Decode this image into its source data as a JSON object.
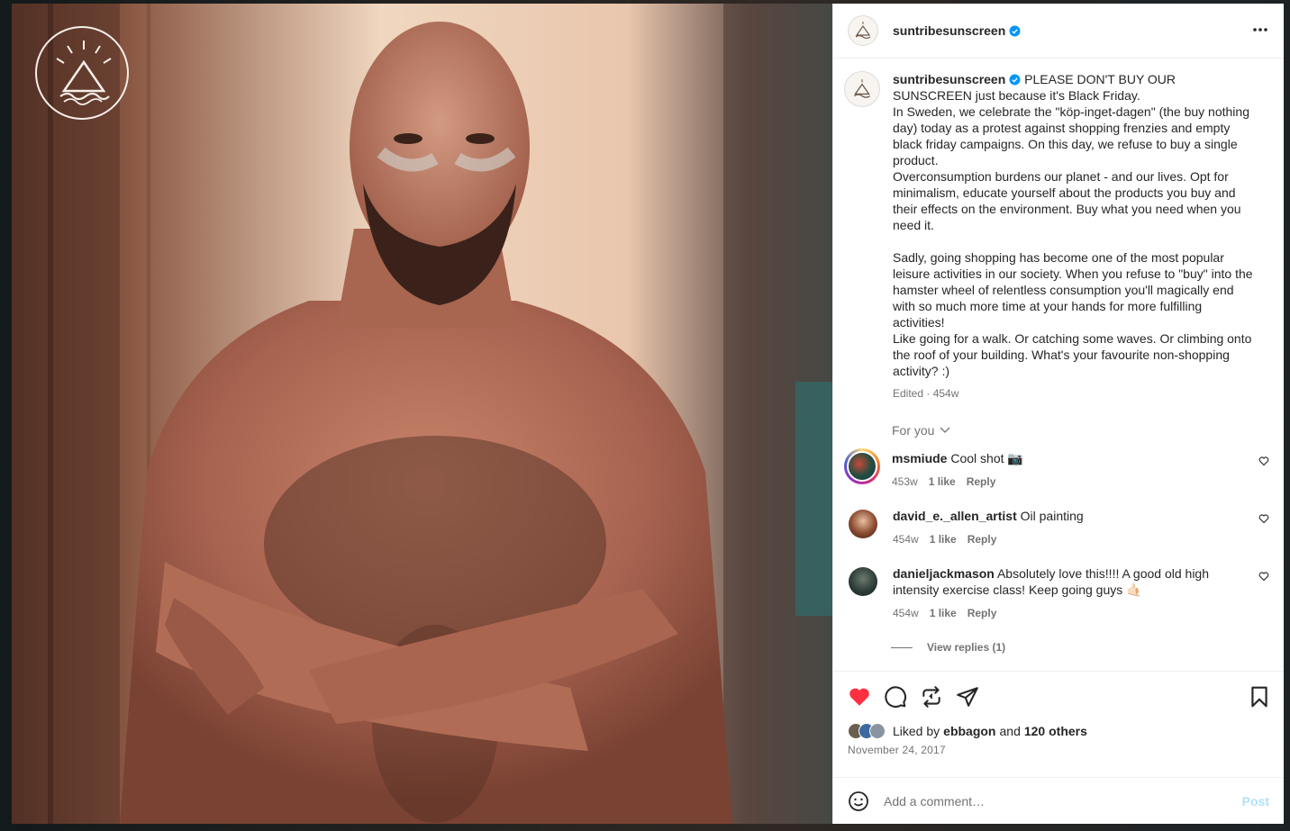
{
  "post": {
    "username": "suntribesunscreen",
    "caption_lead": "PLEASE DON'T BUY OUR SUNSCREEN just because it's Black Friday.",
    "caption_body": "In Sweden, we celebrate the \"köp-inget-dagen\" (the buy nothing day) today as a protest against shopping frenzies and empty black friday campaigns. On this day, we refuse to buy a single product.\nOverconsumption burdens our planet - and our lives. Opt for minimalism, educate yourself about the products you buy and their effects on the environment. Buy what you need when you need it.\n\nSadly, going shopping has become one of the most popular leisure activities in our society. When you refuse to \"buy\" into the hamster wheel of relentless consumption you'll magically end with so much more time at your hands for more fulfilling activities!\nLike going for a walk. Or catching some waves. Or climbing onto the roof of your building. What's your favourite non-shopping activity? :)",
    "caption_meta": "Edited · 454w",
    "sort_label": "For you",
    "liked_by_prefix": "Liked by",
    "liked_by_user": "ebbagon",
    "liked_by_and": "and",
    "liked_by_others": "120 others",
    "date": "November 24, 2017"
  },
  "comments": [
    {
      "user": "msmiude",
      "text": "Cool shot 📷",
      "age": "453w",
      "likes": "1 like",
      "reply": "Reply"
    },
    {
      "user": "david_e._allen_artist",
      "text": "Oil painting",
      "age": "454w",
      "likes": "1 like",
      "reply": "Reply"
    },
    {
      "user": "danieljackmason",
      "text": "Absolutely love this!!!! A good old high intensity exercise class! Keep going guys 🤙🏻",
      "age": "454w",
      "likes": "1 like",
      "reply": "Reply"
    }
  ],
  "view_replies": "View replies (1)",
  "composer": {
    "placeholder": "Add a comment…",
    "post_label": "Post"
  },
  "colors": {
    "like_red": "#ff3040",
    "verified_blue": "#0095f6",
    "post_disabled": "#b2dffc"
  }
}
